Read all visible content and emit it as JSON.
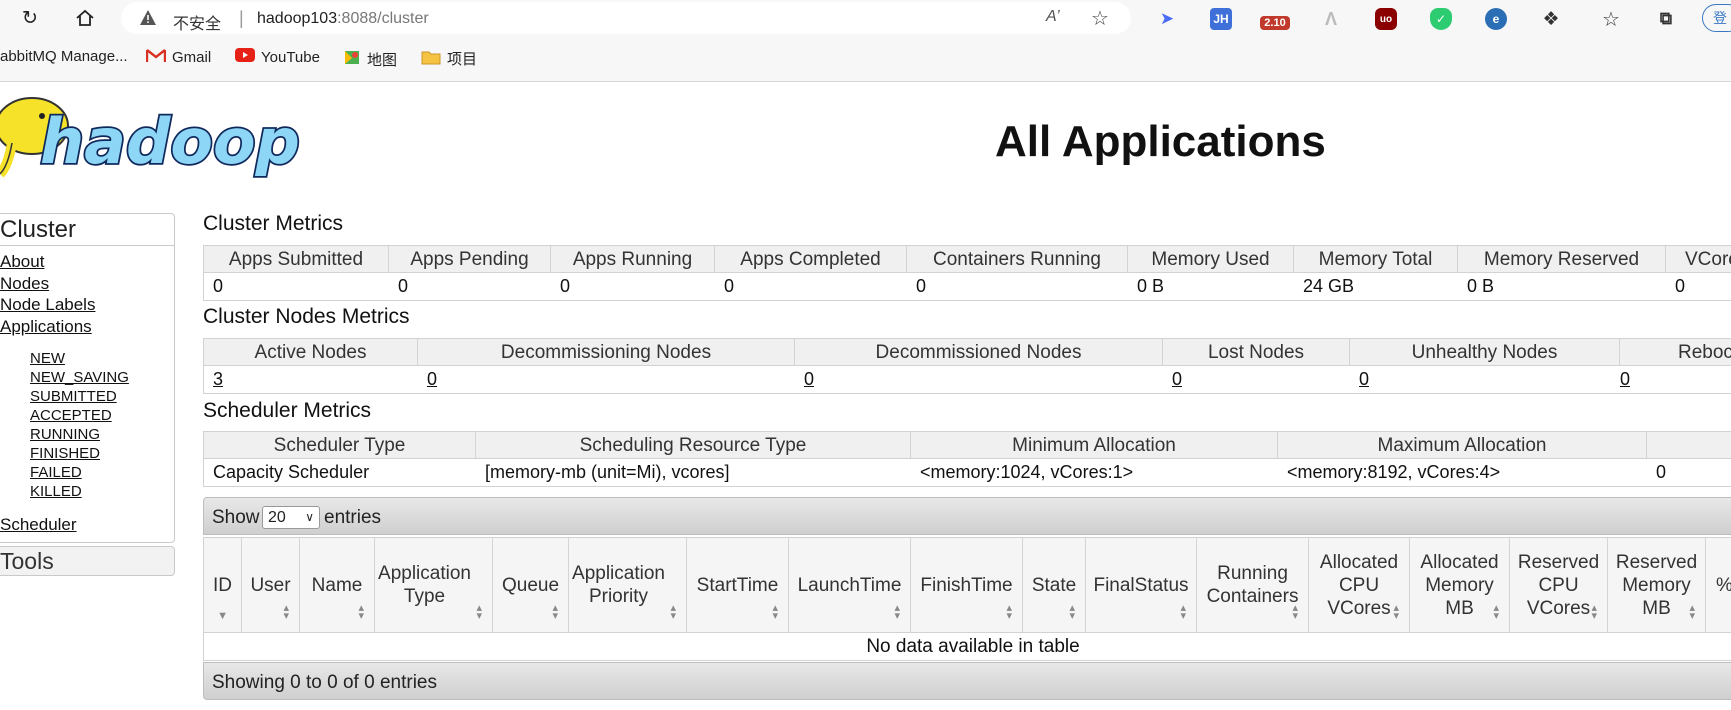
{
  "browser": {
    "security_label": "不安全",
    "address_host": "hadoop103",
    "address_rest": ":8088/cluster",
    "ext_badge": "2.10",
    "profile_label": "登",
    "bookmarks": [
      "abbitMQ Manage...",
      "Gmail",
      "YouTube",
      "地图",
      "项目"
    ]
  },
  "page": {
    "logo_text": "hadoop",
    "title": "All Applications"
  },
  "nav": {
    "cluster_header": "Cluster",
    "items": [
      "About",
      "Nodes",
      "Node Labels",
      "Applications"
    ],
    "app_states": [
      "NEW",
      "NEW_SAVING",
      "SUBMITTED",
      "ACCEPTED",
      "RUNNING",
      "FINISHED",
      "FAILED",
      "KILLED"
    ],
    "scheduler": "Scheduler",
    "tools_header": "Tools"
  },
  "cluster_metrics": {
    "title": "Cluster Metrics",
    "headers": [
      "Apps Submitted",
      "Apps Pending",
      "Apps Running",
      "Apps Completed",
      "Containers Running",
      "Memory Used",
      "Memory Total",
      "Memory Reserved",
      "VCores"
    ],
    "values": [
      "0",
      "0",
      "0",
      "0",
      "0",
      "0 B",
      "24 GB",
      "0 B",
      "0"
    ]
  },
  "node_metrics": {
    "title": "Cluster Nodes Metrics",
    "headers": [
      "Active Nodes",
      "Decommissioning Nodes",
      "Decommissioned Nodes",
      "Lost Nodes",
      "Unhealthy Nodes",
      "Reboc"
    ],
    "values": [
      "3",
      "0",
      "0",
      "0",
      "0",
      "0"
    ]
  },
  "scheduler_metrics": {
    "title": "Scheduler Metrics",
    "headers": [
      "Scheduler Type",
      "Scheduling Resource Type",
      "Minimum Allocation",
      "Maximum Allocation",
      ""
    ],
    "values": [
      "Capacity Scheduler",
      "[memory-mb (unit=Mi), vcores]",
      "<memory:1024, vCores:1>",
      "<memory:8192, vCores:4>",
      "0"
    ]
  },
  "table": {
    "show_label": "Show",
    "page_size": "20",
    "entries_label": "entries",
    "columns": [
      "ID",
      "User",
      "Name",
      "Application Type",
      "Queue",
      "Application Priority",
      "StartTime",
      "LaunchTime",
      "FinishTime",
      "State",
      "FinalStatus",
      "Running Containers",
      "Allocated CPU VCores",
      "Allocated Memory MB",
      "Reserved CPU VCores",
      "Reserved Memory MB",
      "% Qu"
    ],
    "empty_message": "No data available in table",
    "footer": "Showing 0 to 0 of 0 entries"
  }
}
